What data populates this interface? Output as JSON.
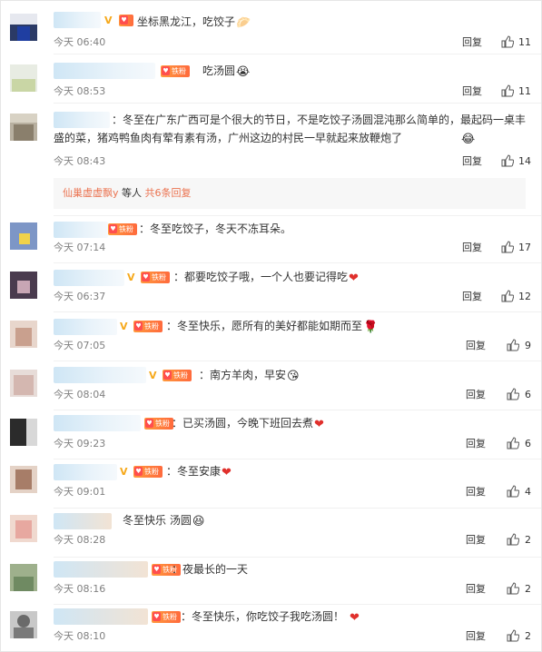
{
  "reply_label": "回复",
  "fan_badge_label": "铁粉",
  "comments": [
    {
      "text": "坐标黑龙江，吃饺子",
      "emoji": "🥟",
      "time": "今天 06:40",
      "likes": "11"
    },
    {
      "text": "吃汤圆",
      "emoji": "😭",
      "time": "今天 08:53",
      "likes": "11"
    },
    {
      "text": "：冬至在广东广西可是个很大的节日，不是吃饺子汤圆混沌那么简单的，最起码一桌丰盛的菜，猪鸡鸭鱼肉有荤有素有汤，广州这边的村民一早就起来放鞭炮了",
      "emoji": "😂",
      "time": "今天 08:43",
      "likes": "14"
    },
    {
      "text": "：冬至吃饺子，冬天不冻耳朵。",
      "emoji": "",
      "time": "今天 07:14",
      "likes": "17"
    },
    {
      "text": "：都要吃饺子哦，一个人也要记得吃",
      "emoji": "❤",
      "time": "今天 06:37",
      "likes": "12"
    },
    {
      "text": "：冬至快乐，愿所有的美好都能如期而至",
      "emoji": "🌹",
      "time": "今天 07:05",
      "likes": "9"
    },
    {
      "text": "：南方羊肉，早安",
      "emoji": "😘",
      "time": "今天 08:04",
      "likes": "6"
    },
    {
      "text": "：已买汤圆，今晚下班回去煮",
      "emoji": "❤",
      "time": "今天 09:23",
      "likes": "6"
    },
    {
      "text": "：冬至安康",
      "emoji": "❤",
      "time": "今天 09:01",
      "likes": "4"
    },
    {
      "text": "冬至快乐 汤圆",
      "emoji": "😆",
      "time": "今天 08:28",
      "likes": "2"
    },
    {
      "text": "：夜最长的一天",
      "emoji": "",
      "time": "今天 08:16",
      "likes": "2"
    },
    {
      "text": "：冬至快乐，你吃饺子我吃汤圆！",
      "emoji": "❤",
      "time": "今天 08:10",
      "likes": "2"
    }
  ],
  "sub_reply": {
    "user": "仙巢虚虚飘y",
    "middle": " 等人 ",
    "link": "共6条回复"
  },
  "icons": {
    "like": "thumb-up-icon",
    "verified": "verified-v-icon",
    "fan": "fan-heart-icon"
  },
  "colors": {
    "link": "#eb7350",
    "time": "#808080",
    "verified": "#f6a91c",
    "name_blur": "#cfe6f5"
  }
}
